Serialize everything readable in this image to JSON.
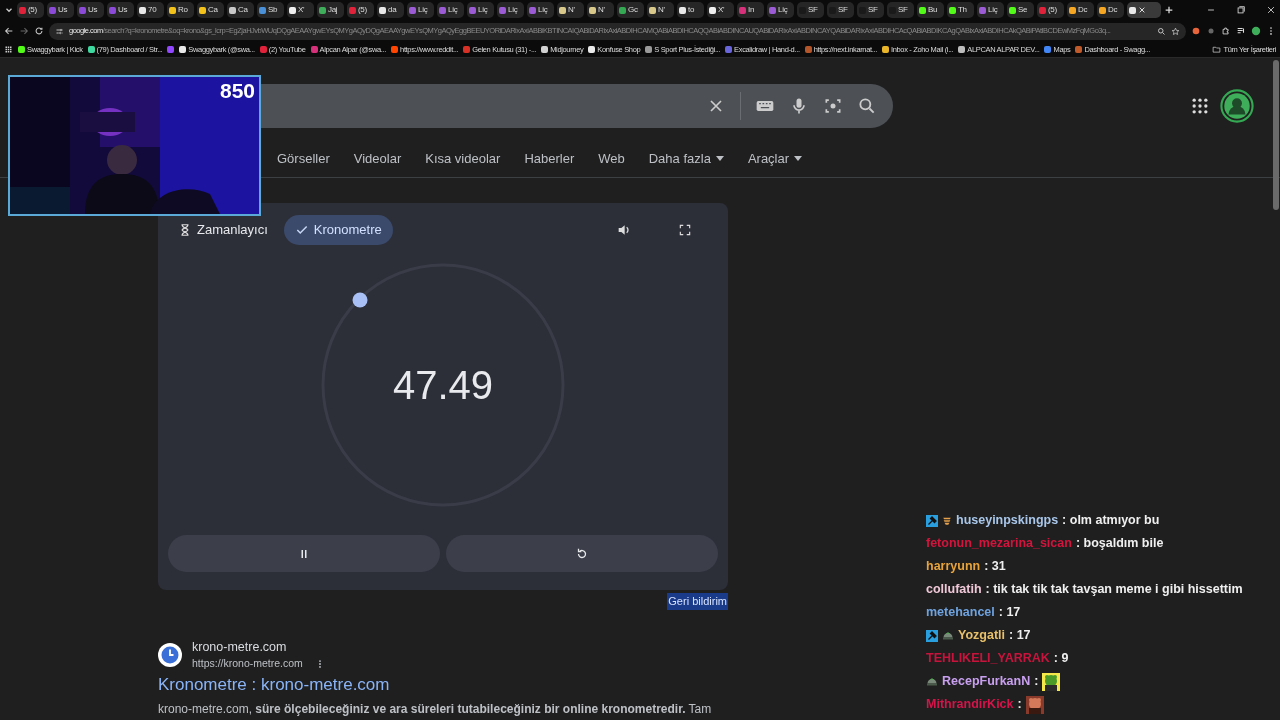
{
  "tabs": [
    {
      "label": "(5)",
      "color": "#e0223a",
      "selected": false
    },
    {
      "label": "Us",
      "color": "#8b4ad8",
      "selected": false
    },
    {
      "label": "Us",
      "color": "#8b4ad8",
      "selected": false
    },
    {
      "label": "Us",
      "color": "#8b4ad8",
      "selected": false
    },
    {
      "label": "70",
      "color": "#e9e9e9",
      "selected": false
    },
    {
      "label": "Ro",
      "color": "#f2c21b",
      "selected": false
    },
    {
      "label": "Ca",
      "color": "#f2c21b",
      "selected": false
    },
    {
      "label": "Ca",
      "color": "#c9c9c9",
      "selected": false
    },
    {
      "label": "Sb",
      "color": "#4a90d9",
      "selected": false
    },
    {
      "label": "X'",
      "color": "#f0f0f0",
      "selected": false
    },
    {
      "label": "Jaj",
      "color": "#3fae5a",
      "selected": false
    },
    {
      "label": "(5)",
      "color": "#e0223a",
      "selected": false
    },
    {
      "label": "da",
      "color": "#e9e9e9",
      "selected": false
    },
    {
      "label": "Liç",
      "color": "#9a5bd4",
      "selected": false
    },
    {
      "label": "Liç",
      "color": "#9a5bd4",
      "selected": false
    },
    {
      "label": "Liç",
      "color": "#9a5bd4",
      "selected": false
    },
    {
      "label": "Liç",
      "color": "#9a5bd4",
      "selected": false
    },
    {
      "label": "Liç",
      "color": "#9a5bd4",
      "selected": false
    },
    {
      "label": "N'",
      "color": "#d8c98a",
      "selected": false
    },
    {
      "label": "N'",
      "color": "#d8c98a",
      "selected": false
    },
    {
      "label": "Gc",
      "color": "#34a853",
      "selected": false
    },
    {
      "label": "N'",
      "color": "#d8c98a",
      "selected": false
    },
    {
      "label": "to",
      "color": "#e9e9e9",
      "selected": false
    },
    {
      "label": "X'",
      "color": "#f0f0f0",
      "selected": false
    },
    {
      "label": "In",
      "color": "#d6307a",
      "selected": false
    },
    {
      "label": "Liç",
      "color": "#9a5bd4",
      "selected": false
    },
    {
      "label": "SF",
      "color": "#1a1a1a",
      "selected": false
    },
    {
      "label": "SF",
      "color": "#1a1a1a",
      "selected": false
    },
    {
      "label": "SF",
      "color": "#1a1a1a",
      "selected": false
    },
    {
      "label": "SF",
      "color": "#1a1a1a",
      "selected": false
    },
    {
      "label": "Bu",
      "color": "#53fc18",
      "selected": false
    },
    {
      "label": "Th",
      "color": "#53fc18",
      "selected": false
    },
    {
      "label": "Liç",
      "color": "#9a5bd4",
      "selected": false
    },
    {
      "label": "Se",
      "color": "#53fc18",
      "selected": false
    },
    {
      "label": "(5)",
      "color": "#e0223a",
      "selected": false
    },
    {
      "label": "Dc",
      "color": "#f5a623",
      "selected": false
    },
    {
      "label": "Dc",
      "color": "#f5a623",
      "selected": false
    },
    {
      "color": "#e9e9e9",
      "selected": true
    }
  ],
  "address_bar": {
    "host": "google.com",
    "path": "/search?q=kronometre&oq=krono&gs_lcrp=EgZjaHJvbWUqDQgAEAAYgwEYsQMYgAQyDQgAEAAYgwEYsQMYgAQyEggBEEUYORiDARixAxiABBiKBTINCAIQABiDARixAxiABDIHCAMQABiABDIHCAQQABiABDINCAUQABiDARixAxiABDINCAYQABiDARixAxiABDIHCAcQABiABDIKCAgQABixAxiABDIHCAkQABiPAtIBCDEwMzFqMGo3q..."
  },
  "bookmarks": [
    {
      "label": "Swaggybark | Kick",
      "color": "#53fc18"
    },
    {
      "label": "(79) Dashboard / Str...",
      "color": "#3fd8a0"
    },
    {
      "color": "#9146ff"
    },
    {
      "label": "Swaggybark (@swa...",
      "color": "#e9e9e9"
    },
    {
      "label": "(2) YouTube",
      "color": "#e0223a"
    },
    {
      "label": "Alpcan Alpar (@swa...",
      "color": "#d6307a"
    },
    {
      "label": "https://www.reddit...",
      "color": "#ff4500"
    },
    {
      "label": "Gelen Kutusu (31) -...",
      "color": "#d93025"
    },
    {
      "label": "Midjourney",
      "color": "#d0d0d0"
    },
    {
      "label": "Konfuse Shop",
      "color": "#e9e9e9"
    },
    {
      "label": "S Sport Plus-İstediği...",
      "color": "#9a9a9a"
    },
    {
      "label": "Excalidraw | Hand-d...",
      "color": "#6965db"
    },
    {
      "label": "https://next.inkarnat...",
      "color": "#b5562a"
    },
    {
      "label": "Inbox - Zoho Mail (i...",
      "color": "#e9b52b"
    },
    {
      "label": "ALPCAN ALPAR DEV...",
      "color": "#bdbdbd"
    },
    {
      "label": "Maps",
      "color": "#4285f4"
    },
    {
      "label": "Dashboard - Swagg...",
      "color": "#c05a2a"
    }
  ],
  "all_bookmarks": "Tüm Yer İşaretleri",
  "webcam": {
    "kind": "picture",
    "counter": "850"
  },
  "search_nav": [
    {
      "label": "Görseller",
      "dropdown": false
    },
    {
      "label": "Videolar",
      "dropdown": false
    },
    {
      "label": "Kısa videolar",
      "dropdown": false
    },
    {
      "label": "Haberler",
      "dropdown": false
    },
    {
      "label": "Web",
      "dropdown": false
    },
    {
      "label": "Daha fazla",
      "dropdown": true
    },
    {
      "label": "Araçlar",
      "dropdown": true
    }
  ],
  "stopwatch": {
    "modes": [
      {
        "label": "Zamanlayıcı",
        "selected": false
      },
      {
        "label": "Kronometre",
        "selected": true
      }
    ],
    "time": "47.49",
    "running": true
  },
  "feedback_link": "Geri bildirim",
  "result": {
    "site": "krono-metre.com",
    "url": "https://krono-metre.com",
    "title": "Kronometre : krono-metre.com",
    "snippet": "krono-metre.com, **süre ölçebileceğiniz ve ara süreleri tutabileceğiniz bir online kronometredir.** Tam"
  },
  "chat": [
    {
      "moderator": true,
      "subscriber": true,
      "helmet": false,
      "user": "huseyinpskingps",
      "color": "#a9c7ea",
      "text": ": olm atmıyor bu"
    },
    {
      "moderator": false,
      "subscriber": false,
      "helmet": false,
      "user": "fetonun_mezarina_sican",
      "color": "#d4143c",
      "text": ": boşaldım bile"
    },
    {
      "moderator": false,
      "subscriber": false,
      "helmet": false,
      "user": "harryunn",
      "color": "#e8a33a",
      "text": ": 31"
    },
    {
      "moderator": false,
      "subscriber": false,
      "helmet": false,
      "user": "collufatih",
      "color": "#f0c8d8",
      "text": ": tik tak tik tak tavşan meme i gibi hissettim"
    },
    {
      "moderator": false,
      "subscriber": false,
      "helmet": false,
      "user": "metehancel",
      "color": "#6fa3e0",
      "text": ": 17"
    },
    {
      "moderator": true,
      "subscriber": false,
      "helmet": true,
      "user": "Yozgatli",
      "color": "#e8c06a",
      "text": ": 17"
    },
    {
      "moderator": false,
      "subscriber": false,
      "helmet": false,
      "user": "TEHLIKELI_YARRAK",
      "color": "#c8143c",
      "text": ": 9"
    },
    {
      "moderator": false,
      "subscriber": false,
      "helmet": true,
      "user": "RecepFurkanN",
      "color": "#c9a0f0",
      "text": ":"
    },
    {
      "moderator": false,
      "subscriber": false,
      "helmet": false,
      "user": "MithrandirKick",
      "color": "#d4144a",
      "text": ":"
    }
  ]
}
